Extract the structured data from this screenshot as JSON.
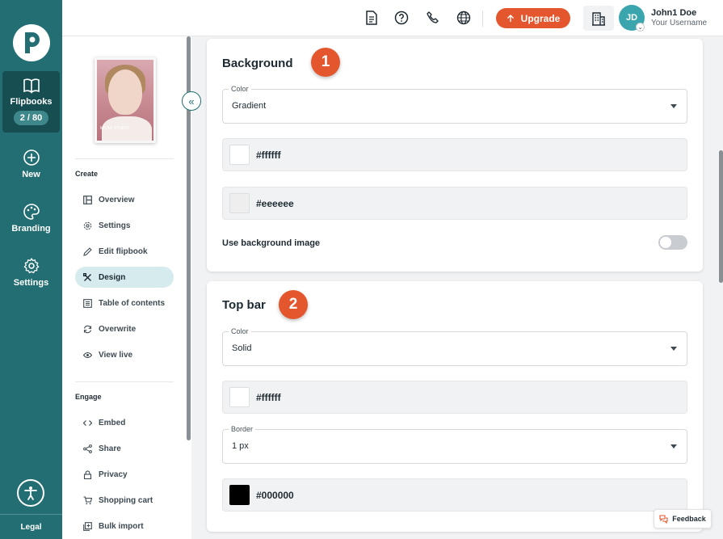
{
  "rail": {
    "items": [
      {
        "label": "Flipbooks",
        "count": "2 / 80",
        "icon": "open-book-icon"
      },
      {
        "label": "New",
        "icon": "plus-circle-icon"
      },
      {
        "label": "Branding",
        "icon": "palette-icon"
      },
      {
        "label": "Settings",
        "icon": "gear-icon"
      }
    ],
    "legal": "Legal"
  },
  "topbar": {
    "upgrade_label": "Upgrade",
    "user": {
      "initials": "JD",
      "name": "John1 Doe",
      "sub": "Your Username"
    }
  },
  "subnav": {
    "thumb_caption": "MILAN STUDIO",
    "create_heading": "Create",
    "create_items": [
      {
        "label": "Overview",
        "icon": "layout-icon"
      },
      {
        "label": "Settings",
        "icon": "gear-icon"
      },
      {
        "label": "Edit flipbook",
        "icon": "pencil-icon"
      },
      {
        "label": "Design",
        "icon": "design-tools-icon"
      },
      {
        "label": "Table of contents",
        "icon": "list-icon"
      },
      {
        "label": "Overwrite",
        "icon": "refresh-icon"
      },
      {
        "label": "View live",
        "icon": "eye-icon"
      }
    ],
    "engage_heading": "Engage",
    "engage_items": [
      {
        "label": "Embed",
        "icon": "code-icon"
      },
      {
        "label": "Share",
        "icon": "share-icon"
      },
      {
        "label": "Privacy",
        "icon": "lock-icon"
      },
      {
        "label": "Shopping cart",
        "icon": "cart-icon"
      },
      {
        "label": "Bulk import",
        "icon": "import-icon"
      }
    ]
  },
  "background": {
    "title": "Background",
    "badge": "1",
    "color_label": "Color",
    "color_value": "Gradient",
    "color1": "#ffffff",
    "color2": "#eeeeee",
    "bg_image_label": "Use background image"
  },
  "top_bar": {
    "title": "Top bar",
    "badge": "2",
    "color_label": "Color",
    "color_value": "Solid",
    "color1": "#ffffff",
    "border_label": "Border",
    "border_value": "1 px",
    "border_color": "#000000"
  },
  "feedback_label": "Feedback"
}
